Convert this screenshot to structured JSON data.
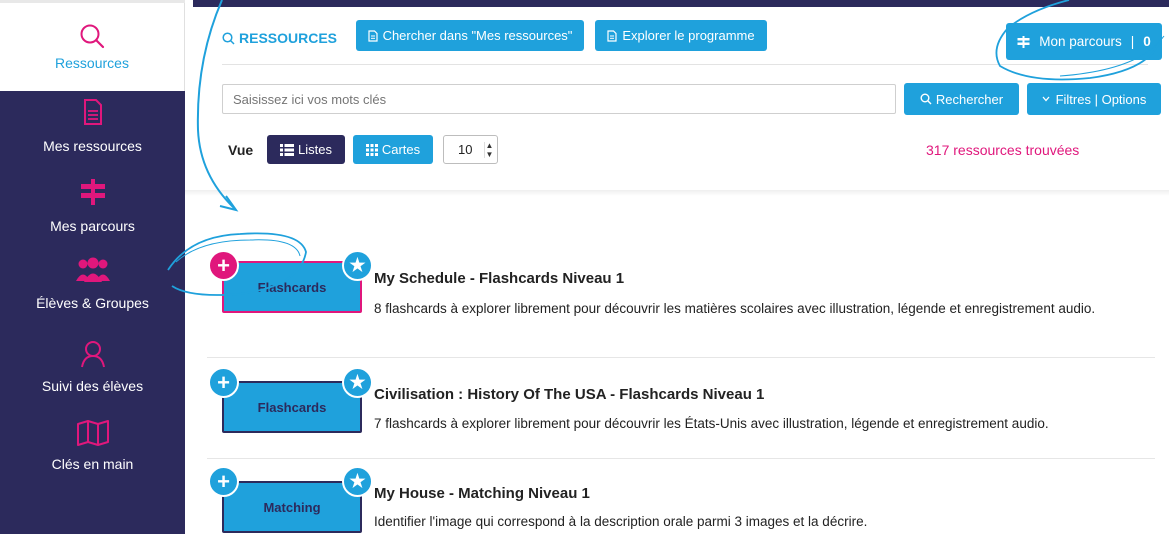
{
  "sidebar": {
    "items": [
      {
        "label": "Ressources",
        "icon": "search-icon",
        "active": true
      },
      {
        "label": "Mes ressources",
        "icon": "document-icon"
      },
      {
        "label": "Mes parcours",
        "icon": "signpost-icon"
      },
      {
        "label": "Élèves & Groupes",
        "icon": "group-icon"
      },
      {
        "label": "Suivi des élèves",
        "icon": "user-outline-icon"
      },
      {
        "label": "Clés en main",
        "icon": "map-icon"
      }
    ]
  },
  "header": {
    "title": "RESSOURCES",
    "search_mine_label": "Chercher dans \"Mes ressources\"",
    "explore_label": "Explorer le programme",
    "parcours_label": "Mon parcours",
    "parcours_count": "0"
  },
  "search": {
    "placeholder": "Saisissez ici vos mots clés",
    "button_label": "Rechercher",
    "filters_label": "Filtres | Options"
  },
  "view": {
    "label": "Vue",
    "list_label": "Listes",
    "cards_label": "Cartes",
    "per_page": "10",
    "results_count": "317 ressources trouvées"
  },
  "resources": [
    {
      "type_label": "Flashcards",
      "title": "My Schedule - Flashcards Niveau 1",
      "description": "8 flashcards à explorer librement pour découvrir les matières scolaires avec illustration, légende et enregistrement audio.",
      "highlighted": true
    },
    {
      "type_label": "Flashcards",
      "title": "Civilisation : History Of The USA - Flashcards Niveau 1",
      "description": "7 flashcards à explorer librement pour découvrir les États-Unis avec illustration, légende et enregistrement audio."
    },
    {
      "type_label": "Matching",
      "title": "My House - Matching Niveau 1",
      "description": "Identifier l'image qui correspond à la description orale parmi 3 images et la décrire."
    }
  ],
  "colors": {
    "navy": "#2c2a5c",
    "blue": "#1fa1dc",
    "pink": "#e0177c"
  }
}
